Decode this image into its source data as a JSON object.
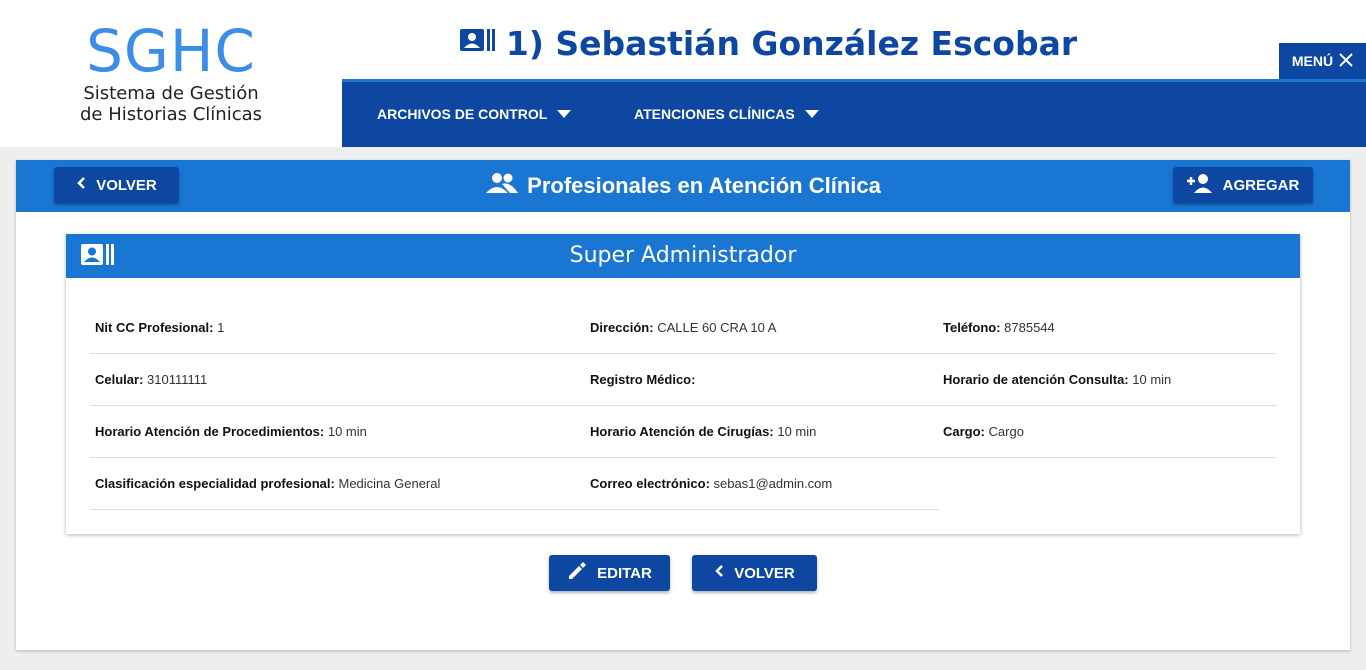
{
  "header": {
    "logo_text": "SGHC",
    "logo_subtitle_1": "Sistema de Gestión",
    "logo_subtitle_2": "de Historias Clínicas",
    "patient_title": "1) Sebastián González Escobar",
    "menu_label": "MENÚ"
  },
  "nav": {
    "items": [
      {
        "label": "ARCHIVOS DE CONTROL"
      },
      {
        "label": "ATENCIONES CLÍNICAS"
      }
    ]
  },
  "page": {
    "back_label": "VOLVER",
    "title": "Profesionales en Atención Clínica",
    "add_label": "AGREGAR"
  },
  "card": {
    "title": "Super Administrador",
    "fields": [
      {
        "label": "Nit CC Profesional:",
        "value": "1"
      },
      {
        "label": "Dirección:",
        "value": "CALLE 60 CRA 10 A"
      },
      {
        "label": "Teléfono:",
        "value": "8785544"
      },
      {
        "label": "Celular:",
        "value": "310111111"
      },
      {
        "label": "Registro Médico:",
        "value": ""
      },
      {
        "label": "Horario de atención Consulta:",
        "value": "10 min"
      },
      {
        "label": "Horario Atención de Procedimientos:",
        "value": "10 min"
      },
      {
        "label": "Horario Atención de Cirugías:",
        "value": "10 min"
      },
      {
        "label": "Cargo:",
        "value": "Cargo"
      },
      {
        "label": "Clasificación especialidad profesional:",
        "value": "Medicina General"
      },
      {
        "label": "Correo electrónico:",
        "value": "sebas1@admin.com"
      }
    ]
  },
  "actions": {
    "edit_label": "EDITAR",
    "back_label": "VOLVER"
  },
  "colors": {
    "primary_dark": "#0d47a1",
    "primary": "#1976d2",
    "logo_blue": "#3b8ee8"
  },
  "icons": [
    "contact-card-icon",
    "close-icon",
    "caret-down-icon",
    "chevron-left-icon",
    "group-icon",
    "person-add-icon",
    "pencil-icon"
  ]
}
